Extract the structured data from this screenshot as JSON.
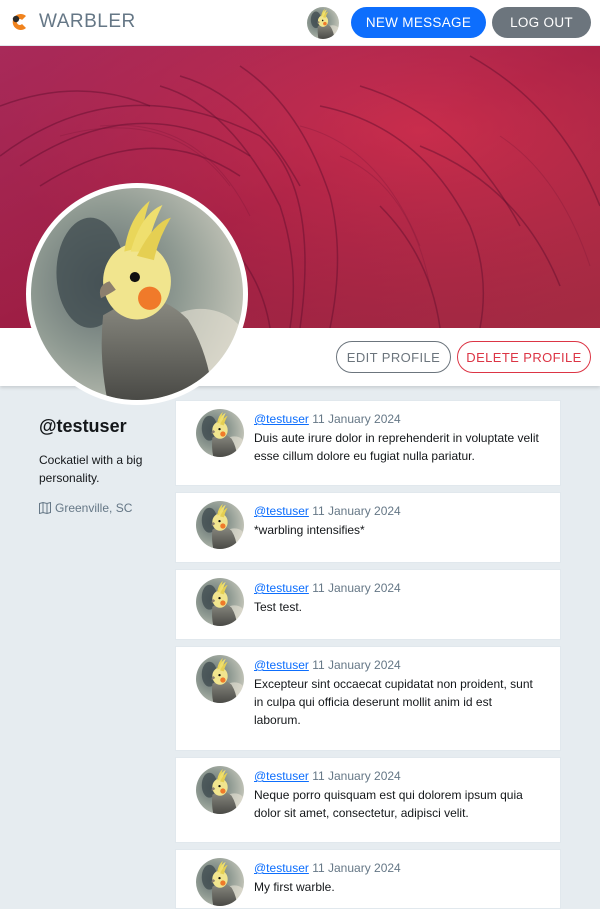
{
  "navbar": {
    "brand": "WARBLER",
    "new_message": "New Message",
    "log_out": "Log out"
  },
  "profile": {
    "username": "@testuser",
    "bio": "Cockatiel with a big personality.",
    "location": "Greenville, SC",
    "edit_label": "Edit Profile",
    "delete_label": "Delete Profile"
  },
  "messages": [
    {
      "user": "@testuser",
      "date": "11 January 2024",
      "text": "Duis aute irure dolor in reprehenderit in voluptate velit esse cillum dolore eu fugiat nulla pariatur."
    },
    {
      "user": "@testuser",
      "date": "11 January 2024",
      "text": "*warbling intensifies*"
    },
    {
      "user": "@testuser",
      "date": "11 January 2024",
      "text": "Test test."
    },
    {
      "user": "@testuser",
      "date": "11 January 2024",
      "text": "Excepteur sint occaecat cupidatat non proident, sunt in culpa qui officia deserunt mollit anim id est laborum."
    },
    {
      "user": "@testuser",
      "date": "11 January 2024",
      "text": "Neque porro quisquam est qui dolorem ipsum quia dolor sit amet, consectetur, adipisci velit."
    },
    {
      "user": "@testuser",
      "date": "11 January 2024",
      "text": "My first warble."
    }
  ],
  "icons": {
    "brand": "warbler-logo-icon",
    "location": "map-icon"
  },
  "colors": {
    "primary": "#0d6efd",
    "secondary": "#6c757d",
    "danger": "#dc3545",
    "background": "#e6ecf0"
  }
}
